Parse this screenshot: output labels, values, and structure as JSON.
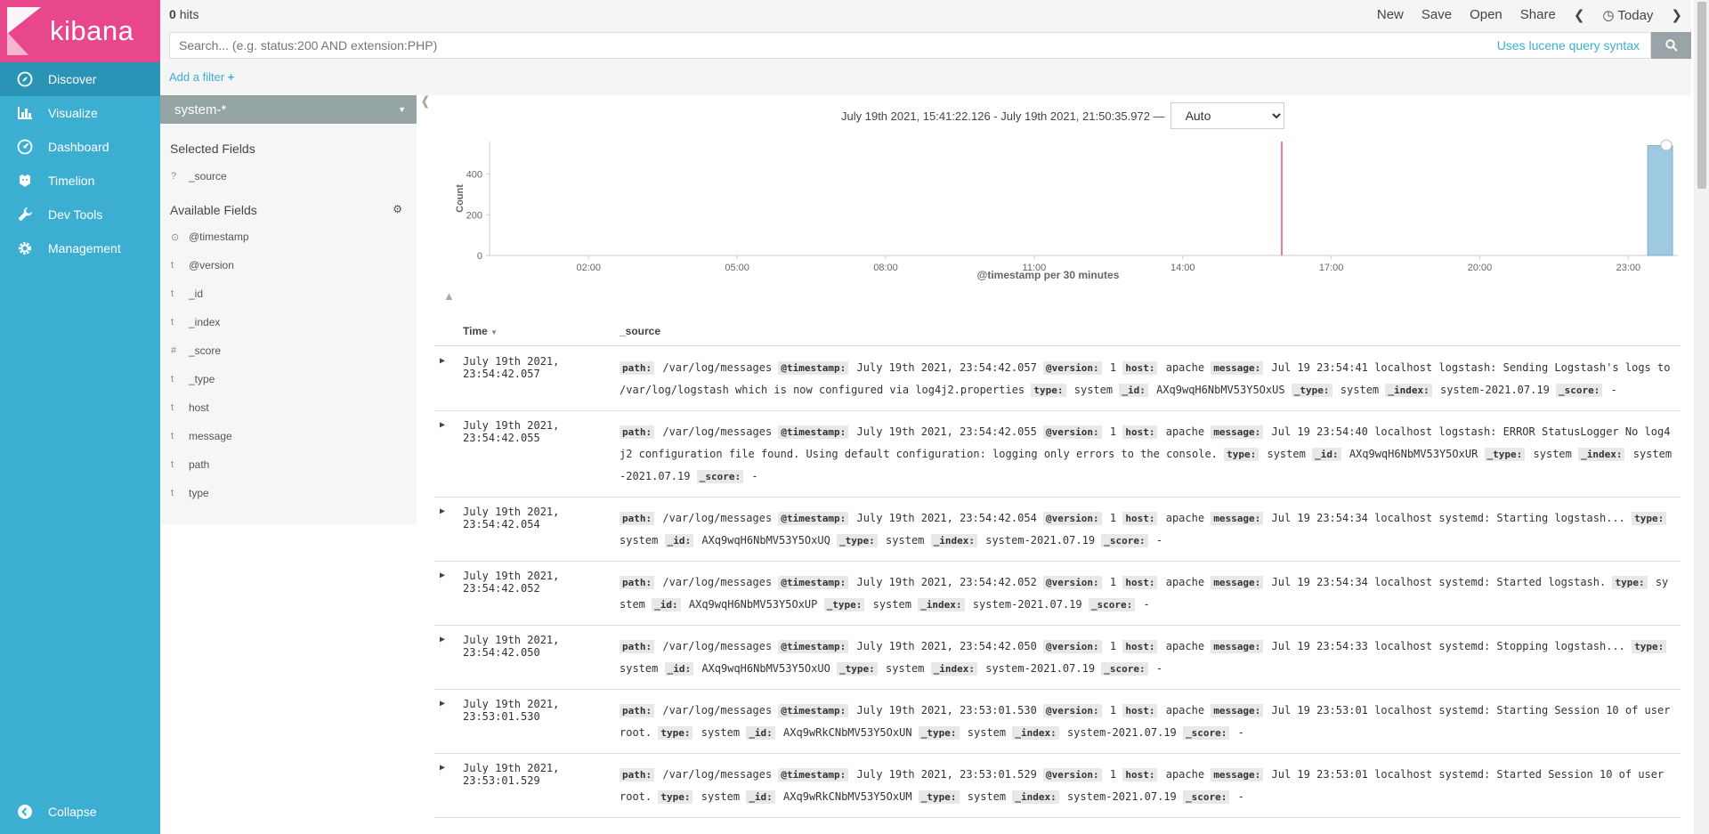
{
  "app": {
    "brand": "kibana"
  },
  "sidebar": {
    "items": [
      {
        "label": "Discover",
        "icon": "compass-icon",
        "active": true
      },
      {
        "label": "Visualize",
        "icon": "bar-chart-icon",
        "active": false
      },
      {
        "label": "Dashboard",
        "icon": "dashboard-icon",
        "active": false
      },
      {
        "label": "Timelion",
        "icon": "timelion-icon",
        "active": false
      },
      {
        "label": "Dev Tools",
        "icon": "wrench-icon",
        "active": false
      },
      {
        "label": "Management",
        "icon": "gear-icon",
        "active": false
      }
    ],
    "collapse_label": "Collapse"
  },
  "topbar": {
    "hits_count": "0",
    "hits_label": "hits",
    "new": "New",
    "save": "Save",
    "open": "Open",
    "share": "Share",
    "time_label": "Today"
  },
  "search": {
    "placeholder": "Search... (e.g. status:200 AND extension:PHP)",
    "lucene_link": "Uses lucene query syntax"
  },
  "filters": {
    "add_label": "Add a filter"
  },
  "fields": {
    "index_pattern": "system-*",
    "selected_heading": "Selected Fields",
    "selected": [
      {
        "type": "?",
        "name": "_source"
      }
    ],
    "available_heading": "Available Fields",
    "available": [
      {
        "type": "⊙",
        "name": "@timestamp"
      },
      {
        "type": "t",
        "name": "@version"
      },
      {
        "type": "t",
        "name": "_id"
      },
      {
        "type": "t",
        "name": "_index"
      },
      {
        "type": "#",
        "name": "_score"
      },
      {
        "type": "t",
        "name": "_type"
      },
      {
        "type": "t",
        "name": "host"
      },
      {
        "type": "t",
        "name": "message"
      },
      {
        "type": "t",
        "name": "path"
      },
      {
        "type": "t",
        "name": "type"
      }
    ]
  },
  "timerange": {
    "text": "July 19th 2021, 15:41:22.126 - July 19th 2021, 21:50:35.972 —",
    "interval": "Auto"
  },
  "chart_data": {
    "type": "bar",
    "ylabel": "Count",
    "xlabel": "@timestamp per 30 minutes",
    "x_ticks": [
      "02:00",
      "05:00",
      "08:00",
      "11:00",
      "14:00",
      "17:00",
      "20:00",
      "23:00"
    ],
    "y_ticks": [
      0,
      200,
      400
    ],
    "ylim": [
      0,
      560
    ],
    "bars": [
      {
        "x": "23:30",
        "value": 540
      }
    ],
    "marker_line": "16:00",
    "colors": {
      "bar": "#9ecae1",
      "marker": "#e8488b"
    }
  },
  "table": {
    "col_time": "Time",
    "col_source": "_source",
    "rows": [
      {
        "time": "July 19th 2021, 23:54:42.057",
        "fields": [
          [
            "path:",
            "/var/log/messages"
          ],
          [
            "@timestamp:",
            "July 19th 2021, 23:54:42.057"
          ],
          [
            "@version:",
            "1"
          ],
          [
            "host:",
            "apache"
          ],
          [
            "message:",
            "Jul 19 23:54:41 localhost logstash: Sending Logstash's logs to /var/log/logstash which is now configured via log4j2.properties"
          ],
          [
            "type:",
            "system"
          ],
          [
            "_id:",
            "AXq9wqH6NbMV53Y5OxUS"
          ],
          [
            "_type:",
            "system"
          ],
          [
            "_index:",
            "system-2021.07.19"
          ],
          [
            "_score:",
            "-"
          ]
        ]
      },
      {
        "time": "July 19th 2021, 23:54:42.055",
        "fields": [
          [
            "path:",
            "/var/log/messages"
          ],
          [
            "@timestamp:",
            "July 19th 2021, 23:54:42.055"
          ],
          [
            "@version:",
            "1"
          ],
          [
            "host:",
            "apache"
          ],
          [
            "message:",
            "Jul 19 23:54:40 localhost logstash: ERROR StatusLogger No log4j2 configuration file found. Using default configuration: logging only errors to the console."
          ],
          [
            "type:",
            "system"
          ],
          [
            "_id:",
            "AXq9wqH6NbMV53Y5OxUR"
          ],
          [
            "_type:",
            "system"
          ],
          [
            "_index:",
            "system-2021.07.19"
          ],
          [
            "_score:",
            "-"
          ]
        ]
      },
      {
        "time": "July 19th 2021, 23:54:42.054",
        "fields": [
          [
            "path:",
            "/var/log/messages"
          ],
          [
            "@timestamp:",
            "July 19th 2021, 23:54:42.054"
          ],
          [
            "@version:",
            "1"
          ],
          [
            "host:",
            "apache"
          ],
          [
            "message:",
            "Jul 19 23:54:34 localhost systemd: Starting logstash..."
          ],
          [
            "type:",
            "system"
          ],
          [
            "_id:",
            "AXq9wqH6NbMV53Y5OxUQ"
          ],
          [
            "_type:",
            "system"
          ],
          [
            "_index:",
            "system-2021.07.19"
          ],
          [
            "_score:",
            "-"
          ]
        ]
      },
      {
        "time": "July 19th 2021, 23:54:42.052",
        "fields": [
          [
            "path:",
            "/var/log/messages"
          ],
          [
            "@timestamp:",
            "July 19th 2021, 23:54:42.052"
          ],
          [
            "@version:",
            "1"
          ],
          [
            "host:",
            "apache"
          ],
          [
            "message:",
            "Jul 19 23:54:34 localhost systemd: Started logstash."
          ],
          [
            "type:",
            "system"
          ],
          [
            "_id:",
            "AXq9wqH6NbMV53Y5OxUP"
          ],
          [
            "_type:",
            "system"
          ],
          [
            "_index:",
            "system-2021.07.19"
          ],
          [
            "_score:",
            "-"
          ]
        ]
      },
      {
        "time": "July 19th 2021, 23:54:42.050",
        "fields": [
          [
            "path:",
            "/var/log/messages"
          ],
          [
            "@timestamp:",
            "July 19th 2021, 23:54:42.050"
          ],
          [
            "@version:",
            "1"
          ],
          [
            "host:",
            "apache"
          ],
          [
            "message:",
            "Jul 19 23:54:33 localhost systemd: Stopping logstash..."
          ],
          [
            "type:",
            "system"
          ],
          [
            "_id:",
            "AXq9wqH6NbMV53Y5OxUO"
          ],
          [
            "_type:",
            "system"
          ],
          [
            "_index:",
            "system-2021.07.19"
          ],
          [
            "_score:",
            "-"
          ]
        ]
      },
      {
        "time": "July 19th 2021, 23:53:01.530",
        "fields": [
          [
            "path:",
            "/var/log/messages"
          ],
          [
            "@timestamp:",
            "July 19th 2021, 23:53:01.530"
          ],
          [
            "@version:",
            "1"
          ],
          [
            "host:",
            "apache"
          ],
          [
            "message:",
            "Jul 19 23:53:01 localhost systemd: Starting Session 10 of user root."
          ],
          [
            "type:",
            "system"
          ],
          [
            "_id:",
            "AXq9wRkCNbMV53Y5OxUN"
          ],
          [
            "_type:",
            "system"
          ],
          [
            "_index:",
            "system-2021.07.19"
          ],
          [
            "_score:",
            "-"
          ]
        ]
      },
      {
        "time": "July 19th 2021, 23:53:01.529",
        "fields": [
          [
            "path:",
            "/var/log/messages"
          ],
          [
            "@timestamp:",
            "July 19th 2021, 23:53:01.529"
          ],
          [
            "@version:",
            "1"
          ],
          [
            "host:",
            "apache"
          ],
          [
            "message:",
            "Jul 19 23:53:01 localhost systemd: Started Session 10 of user root."
          ],
          [
            "type:",
            "system"
          ],
          [
            "_id:",
            "AXq9wRkCNbMV53Y5OxUM"
          ],
          [
            "_type:",
            "system"
          ],
          [
            "_index:",
            "system-2021.07.19"
          ],
          [
            "_score:",
            "-"
          ]
        ]
      }
    ]
  }
}
